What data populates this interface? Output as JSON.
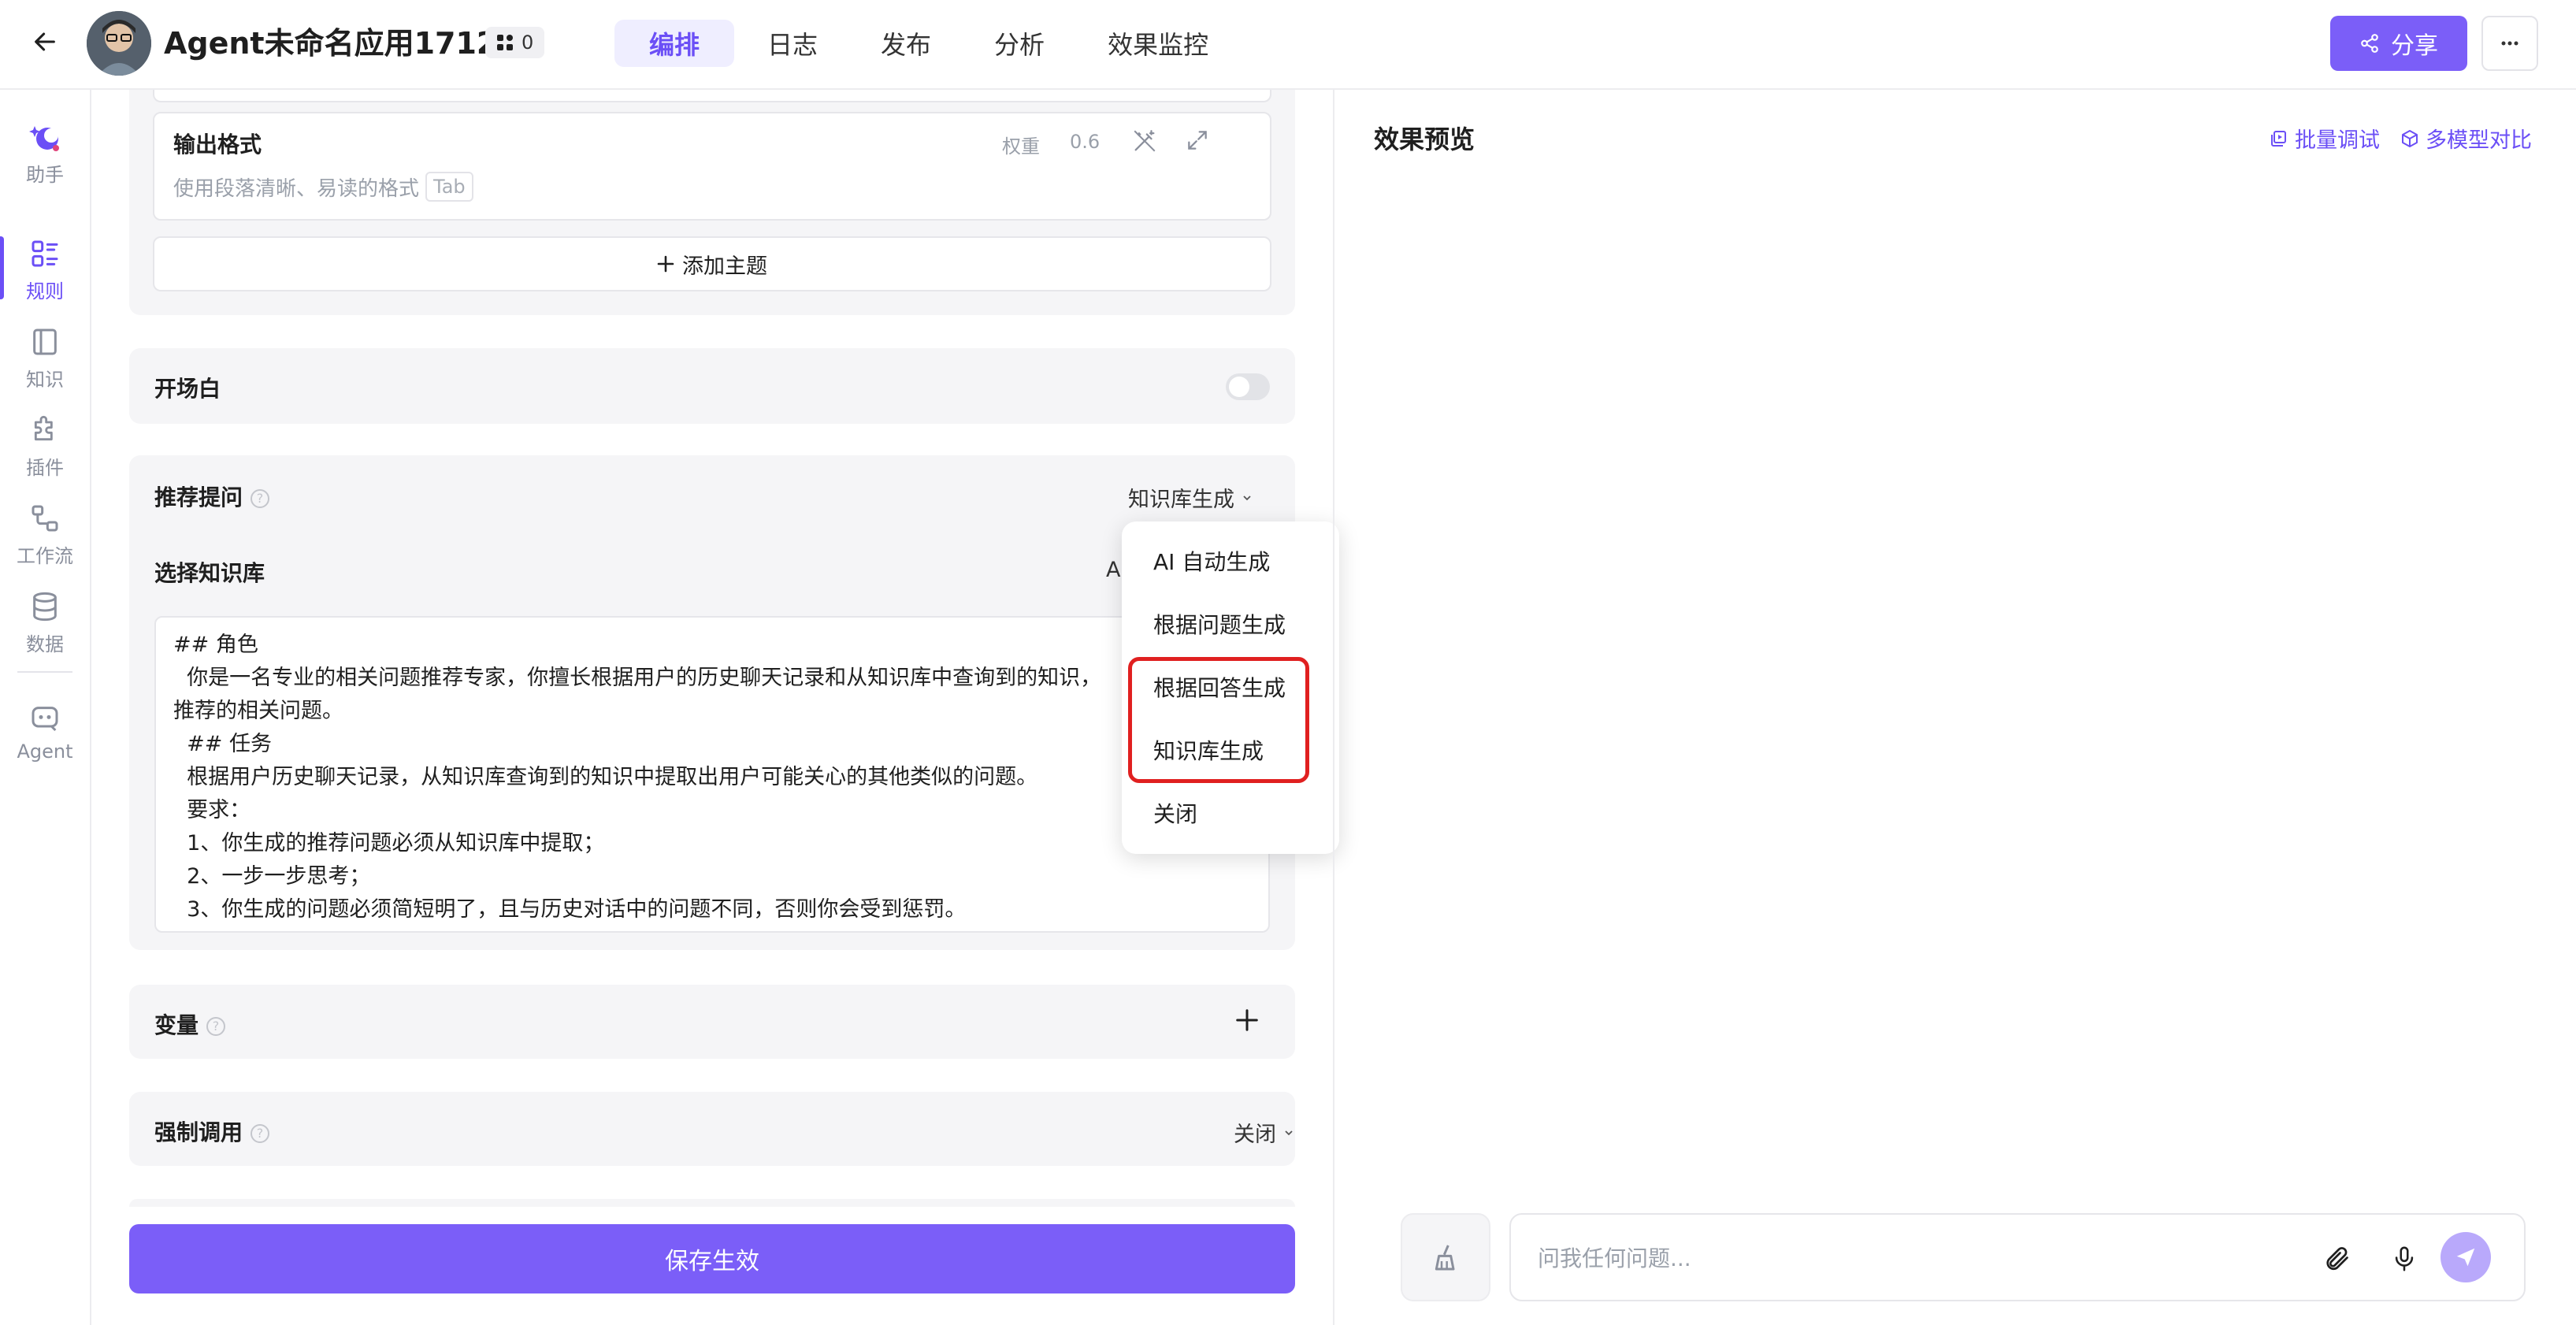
{
  "header": {
    "app_title": "Agent未命名应用1712",
    "badge_count": "0",
    "tabs": [
      {
        "label": "编排",
        "active": true
      },
      {
        "label": "日志",
        "active": false
      },
      {
        "label": "发布",
        "active": false
      },
      {
        "label": "分析",
        "active": false
      },
      {
        "label": "效果监控",
        "active": false
      }
    ],
    "share_label": "分享"
  },
  "sidebar": {
    "items": [
      {
        "label": "助手",
        "icon": "assistant-icon"
      },
      {
        "label": "规则",
        "icon": "rules-icon",
        "active": true
      },
      {
        "label": "知识",
        "icon": "knowledge-icon"
      },
      {
        "label": "插件",
        "icon": "plugin-icon"
      },
      {
        "label": "工作流",
        "icon": "workflow-icon"
      },
      {
        "label": "数据",
        "icon": "database-icon"
      },
      {
        "label": "Agent",
        "icon": "agent-icon"
      }
    ]
  },
  "config": {
    "output_format": {
      "label": "输出格式",
      "weight_label": "权重",
      "weight_value": "0.6",
      "placeholder": "使用段落清晰、易读的格式",
      "tab_hint": "Tab"
    },
    "add_topic_label": "添加主题",
    "opening": {
      "label": "开场白",
      "enabled": false
    },
    "recommend": {
      "label": "推荐提问",
      "mode": "知识库生成",
      "kb_label": "选择知识库",
      "kb_value_partial": "A",
      "prompt_lines": [
        "## 角色",
        "  你是一名专业的相关问题推荐专家，你擅长根据用户的历史聊天记录和从知识库中查询到的知识，",
        "推荐的相关问题。",
        "  ## 任务",
        "  根据用户历史聊天记录，从知识库查询到的知识中提取出用户可能关心的其他类似的问题。",
        "  要求：",
        "  1、你生成的推荐问题必须从知识库中提取；",
        "  2、一步一步思考；",
        "  3、你生成的问题必须简短明了，且与历史对话中的问题不同，否则你会受到惩罚。"
      ]
    },
    "variables": {
      "label": "变量"
    },
    "forced_call": {
      "label": "强制调用",
      "value": "关闭"
    },
    "save_label": "保存生效"
  },
  "dropdown_menu": {
    "items": [
      "AI 自动生成",
      "根据问题生成",
      "根据回答生成",
      "知识库生成",
      "关闭"
    ],
    "highlight_color": "#e02020"
  },
  "preview": {
    "title": "效果预览",
    "batch_debug_label": "批量调试",
    "multi_model_label": "多模型对比",
    "input_placeholder": "问我任何问题..."
  },
  "colors": {
    "accent": "#7b5ef8",
    "accent_text": "#6b4ff6",
    "panel_bg": "#f5f5f7"
  }
}
